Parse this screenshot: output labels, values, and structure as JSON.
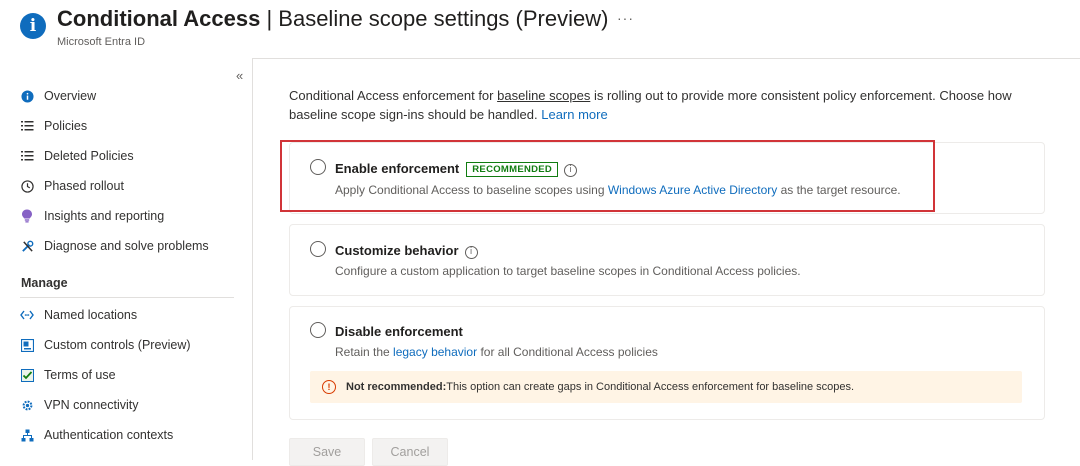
{
  "header": {
    "title_bold": "Conditional Access",
    "title_rest": " | Baseline scope settings (Preview)",
    "subtitle": "Microsoft Entra ID",
    "more": "···"
  },
  "sidebar": {
    "collapse": "«",
    "items": [
      {
        "label": "Overview",
        "icon": "info-icon"
      },
      {
        "label": "Policies",
        "icon": "list-icon"
      },
      {
        "label": "Deleted Policies",
        "icon": "list-icon"
      },
      {
        "label": "Phased rollout",
        "icon": "clock-icon"
      },
      {
        "label": "Insights and reporting",
        "icon": "bulb-icon"
      },
      {
        "label": "Diagnose and solve problems",
        "icon": "wrench-icon"
      }
    ],
    "manage_label": "Manage",
    "manage_items": [
      {
        "label": "Named locations",
        "icon": "arrows-icon"
      },
      {
        "label": "Custom controls (Preview)",
        "icon": "controls-icon"
      },
      {
        "label": "Terms of use",
        "icon": "checklist-icon"
      },
      {
        "label": "VPN connectivity",
        "icon": "gear-icon"
      },
      {
        "label": "Authentication contexts",
        "icon": "hierarchy-icon"
      }
    ]
  },
  "main": {
    "intro_pre": "Conditional Access enforcement for ",
    "intro_link1": "baseline scopes",
    "intro_mid": " is rolling out to provide more consistent policy enforcement. Choose how baseline scope sign-ins should be handled. ",
    "intro_link2": "Learn more",
    "options": [
      {
        "title": "Enable enforcement",
        "badge": "RECOMMENDED",
        "desc_pre": "Apply Conditional Access to baseline scopes using ",
        "desc_link": "Windows Azure Active Directory",
        "desc_post": " as the target resource."
      },
      {
        "title": "Customize behavior",
        "desc": "Configure a custom application to target baseline scopes in Conditional Access policies."
      },
      {
        "title": "Disable enforcement",
        "desc_pre": "Retain the ",
        "desc_link": "legacy behavior",
        "desc_post": " for all Conditional Access policies",
        "warning_bold": "Not recommended:",
        "warning_text": " This option can create gaps in Conditional Access enforcement for baseline scopes."
      }
    ],
    "save_label": "Save",
    "cancel_label": "Cancel"
  },
  "colors": {
    "accent": "#0f6cbd",
    "highlight_border": "#d13438",
    "badge": "#107c10",
    "warning_bg": "#fff4e5",
    "warning_icon": "#d83b01"
  }
}
